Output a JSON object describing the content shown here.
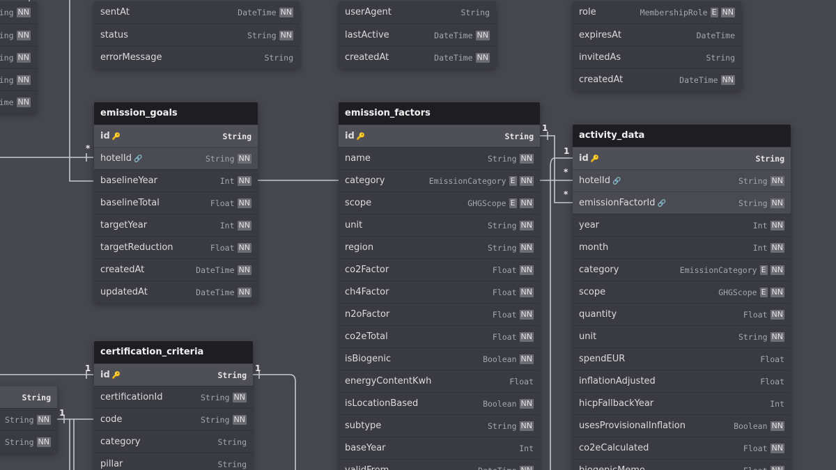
{
  "tables": {
    "left_top": {
      "rows": [
        {
          "type": "ing",
          "nn": "NN"
        },
        {
          "type": "ing",
          "nn": "NN"
        },
        {
          "type": "ing",
          "nn": "NN"
        },
        {
          "type": "ing",
          "nn": "NN"
        },
        {
          "type": "ime",
          "nn": "NN"
        }
      ]
    },
    "notifications_partial": {
      "rows": [
        {
          "name": "sentAt",
          "type": "DateTime",
          "nn": "NN"
        },
        {
          "name": "status",
          "type": "String",
          "nn": "NN"
        },
        {
          "name": "errorMessage",
          "type": "String",
          "nn": ""
        }
      ]
    },
    "sessions_partial": {
      "rows": [
        {
          "name": "userAgent",
          "type": "String",
          "nn": ""
        },
        {
          "name": "lastActive",
          "type": "DateTime",
          "nn": "NN"
        },
        {
          "name": "createdAt",
          "type": "DateTime",
          "nn": "NN"
        }
      ]
    },
    "memberships_partial": {
      "rows": [
        {
          "name": "role",
          "type": "MembershipRole",
          "enum": "E",
          "nn": "NN"
        },
        {
          "name": "expiresAt",
          "type": "DateTime",
          "nn": ""
        },
        {
          "name": "invitedAs",
          "type": "String",
          "nn": ""
        },
        {
          "name": "createdAt",
          "type": "DateTime",
          "nn": "NN"
        }
      ]
    },
    "emission_goals": {
      "title": "emission_goals",
      "rows": [
        {
          "name": "id",
          "type": "String",
          "pk": true,
          "key_icon": "🔑"
        },
        {
          "name": "hotelId",
          "type": "String",
          "nn": "NN",
          "fk": true,
          "link_icon": "🔗"
        },
        {
          "name": "baselineYear",
          "type": "Int",
          "nn": "NN"
        },
        {
          "name": "baselineTotal",
          "type": "Float",
          "nn": "NN"
        },
        {
          "name": "targetYear",
          "type": "Int",
          "nn": "NN"
        },
        {
          "name": "targetReduction",
          "type": "Float",
          "nn": "NN"
        },
        {
          "name": "createdAt",
          "type": "DateTime",
          "nn": "NN"
        },
        {
          "name": "updatedAt",
          "type": "DateTime",
          "nn": "NN"
        }
      ]
    },
    "emission_factors": {
      "title": "emission_factors",
      "rows": [
        {
          "name": "id",
          "type": "String",
          "pk": true,
          "key_icon": "🔑"
        },
        {
          "name": "name",
          "type": "String",
          "nn": "NN"
        },
        {
          "name": "category",
          "type": "EmissionCategory",
          "enum": "E",
          "nn": "NN"
        },
        {
          "name": "scope",
          "type": "GHGScope",
          "enum": "E",
          "nn": "NN"
        },
        {
          "name": "unit",
          "type": "String",
          "nn": "NN"
        },
        {
          "name": "region",
          "type": "String",
          "nn": "NN"
        },
        {
          "name": "co2Factor",
          "type": "Float",
          "nn": "NN"
        },
        {
          "name": "ch4Factor",
          "type": "Float",
          "nn": "NN"
        },
        {
          "name": "n2oFactor",
          "type": "Float",
          "nn": "NN"
        },
        {
          "name": "co2eTotal",
          "type": "Float",
          "nn": "NN"
        },
        {
          "name": "isBiogenic",
          "type": "Boolean",
          "nn": "NN"
        },
        {
          "name": "energyContentKwh",
          "type": "Float",
          "nn": ""
        },
        {
          "name": "isLocationBased",
          "type": "Boolean",
          "nn": "NN"
        },
        {
          "name": "subtype",
          "type": "String",
          "nn": "NN"
        },
        {
          "name": "baseYear",
          "type": "Int",
          "nn": ""
        },
        {
          "name": "validFrom",
          "type": "DateTime",
          "nn": "NN"
        }
      ]
    },
    "activity_data": {
      "title": "activity_data",
      "rows": [
        {
          "name": "id",
          "type": "String",
          "pk": true,
          "key_icon": "🔑"
        },
        {
          "name": "hotelId",
          "type": "String",
          "nn": "NN",
          "fk": true,
          "link_icon": "🔗"
        },
        {
          "name": "emissionFactorId",
          "type": "String",
          "nn": "NN",
          "fk": true,
          "link_icon": "🔗"
        },
        {
          "name": "year",
          "type": "Int",
          "nn": "NN"
        },
        {
          "name": "month",
          "type": "Int",
          "nn": "NN"
        },
        {
          "name": "category",
          "type": "EmissionCategory",
          "enum": "E",
          "nn": "NN"
        },
        {
          "name": "scope",
          "type": "GHGScope",
          "enum": "E",
          "nn": "NN"
        },
        {
          "name": "quantity",
          "type": "Float",
          "nn": "NN"
        },
        {
          "name": "unit",
          "type": "String",
          "nn": "NN"
        },
        {
          "name": "spendEUR",
          "type": "Float",
          "nn": ""
        },
        {
          "name": "inflationAdjusted",
          "type": "Float",
          "nn": ""
        },
        {
          "name": "hicpFallbackYear",
          "type": "Int",
          "nn": ""
        },
        {
          "name": "usesProvisionalInflation",
          "type": "Boolean",
          "nn": "NN"
        },
        {
          "name": "co2eCalculated",
          "type": "Float",
          "nn": "NN"
        },
        {
          "name": "biogenicMemo",
          "type": "Float",
          "nn": "NN"
        }
      ]
    },
    "certification_criteria": {
      "title": "certification_criteria",
      "rows": [
        {
          "name": "id",
          "type": "String",
          "pk": true,
          "key_icon": "🔑"
        },
        {
          "name": "certificationId",
          "type": "String",
          "nn": "NN"
        },
        {
          "name": "code",
          "type": "String",
          "nn": "NN"
        },
        {
          "name": "category",
          "type": "String",
          "nn": ""
        },
        {
          "name": "pillar",
          "type": "String",
          "nn": ""
        }
      ]
    },
    "left_bottom": {
      "rows": [
        {
          "type": "String",
          "pk": true,
          "nn": ""
        },
        {
          "type": "String",
          "nn": "NN"
        },
        {
          "type": "String",
          "nn": "NN"
        }
      ]
    }
  },
  "cardinality": {
    "goals_hotel_many": "*",
    "factors_one": "1",
    "activity_one": "1",
    "activity_hotel_many": "*",
    "activity_factor_many": "*",
    "criteria_one_left": "1",
    "criteria_one_right": "1",
    "left_bottom_one": "1"
  }
}
